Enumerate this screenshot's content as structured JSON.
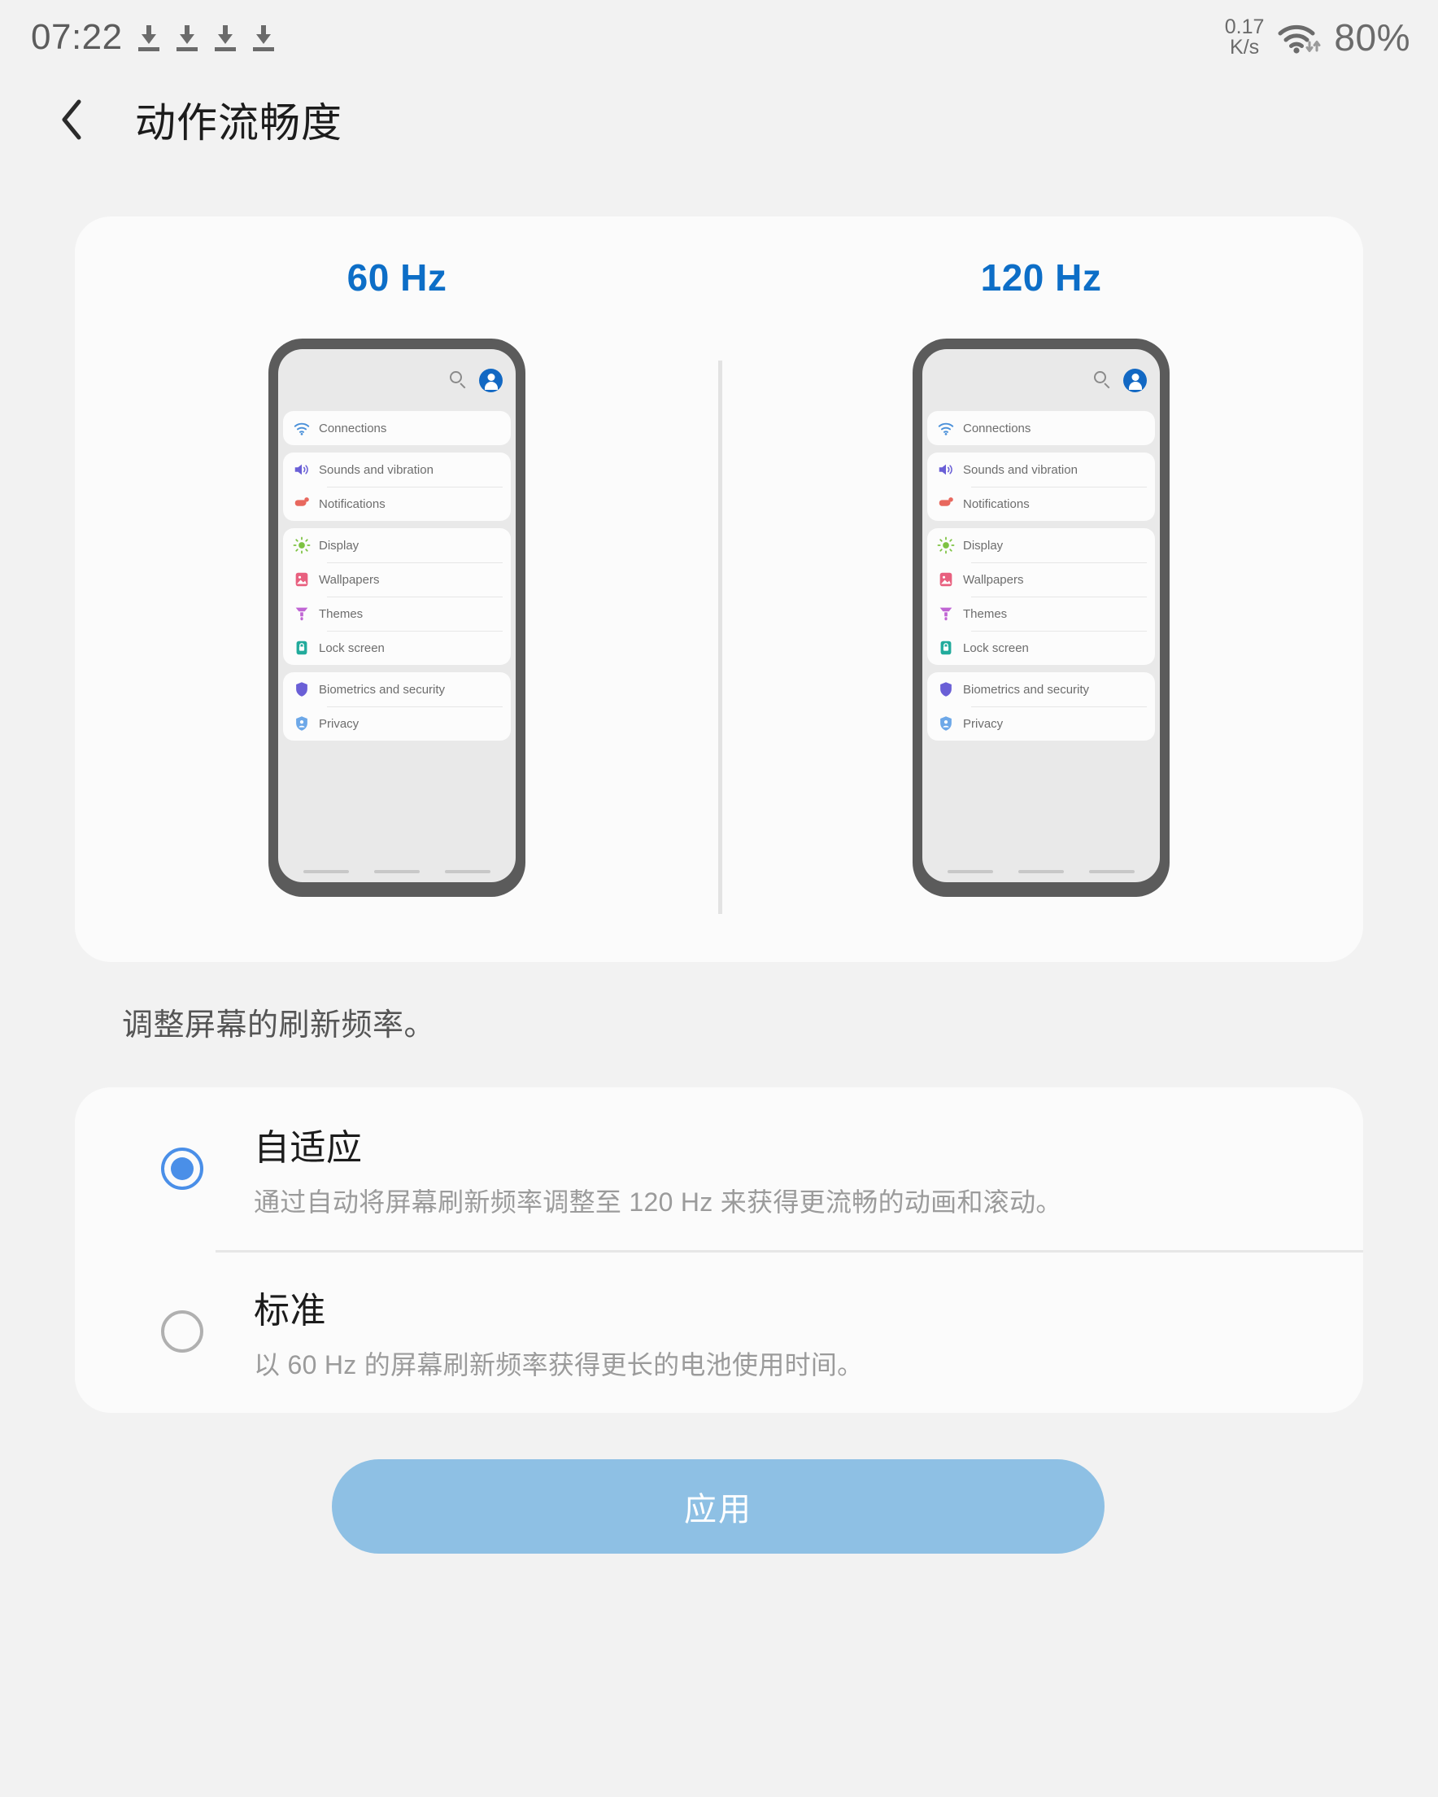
{
  "status_bar": {
    "time": "07:22",
    "download_icons": [
      "download-icon",
      "download-icon",
      "download-icon",
      "download-icon"
    ],
    "net_speed_value": "0.17",
    "net_speed_unit": "K/s",
    "wifi_icon": "wifi-icon",
    "battery": "80%"
  },
  "header": {
    "back_icon": "back-chevron-icon",
    "title": "动作流畅度"
  },
  "preview": {
    "left_label": "60 Hz",
    "right_label": "120 Hz",
    "accent_color": "#0d6ec7",
    "phone_screen": {
      "search_icon": "search-icon",
      "avatar_icon": "account-avatar-icon",
      "groups": [
        {
          "rows": [
            {
              "icon": "wifi-icon",
              "label": "Connections",
              "color": "#4a90d9"
            }
          ]
        },
        {
          "rows": [
            {
              "icon": "speaker-icon",
              "label": "Sounds and vibration",
              "color": "#6a5fd6"
            },
            {
              "icon": "notification-icon",
              "label": "Notifications",
              "color": "#e8685e"
            }
          ]
        },
        {
          "rows": [
            {
              "icon": "brightness-icon",
              "label": "Display",
              "color": "#7dc242"
            },
            {
              "icon": "wallpaper-icon",
              "label": "Wallpapers",
              "color": "#e8607f"
            },
            {
              "icon": "themes-icon",
              "label": "Themes",
              "color": "#c065d4"
            },
            {
              "icon": "lock-icon",
              "label": "Lock screen",
              "color": "#22ab9c"
            }
          ]
        },
        {
          "rows": [
            {
              "icon": "shield-icon",
              "label": "Biometrics and security",
              "color": "#6a5fd6"
            },
            {
              "icon": "privacy-icon",
              "label": "Privacy",
              "color": "#6da8e8"
            }
          ]
        }
      ]
    }
  },
  "description": "调整屏幕的刷新频率。",
  "options": [
    {
      "title": "自适应",
      "subtitle": "通过自动将屏幕刷新频率调整至 120 Hz 来获得更流畅的动画和滚动。",
      "selected": true
    },
    {
      "title": "标准",
      "subtitle": "以 60 Hz 的屏幕刷新频率获得更长的电池使用时间。",
      "selected": false
    }
  ],
  "apply_button": {
    "label": "应用",
    "color": "#8ec0e4"
  }
}
